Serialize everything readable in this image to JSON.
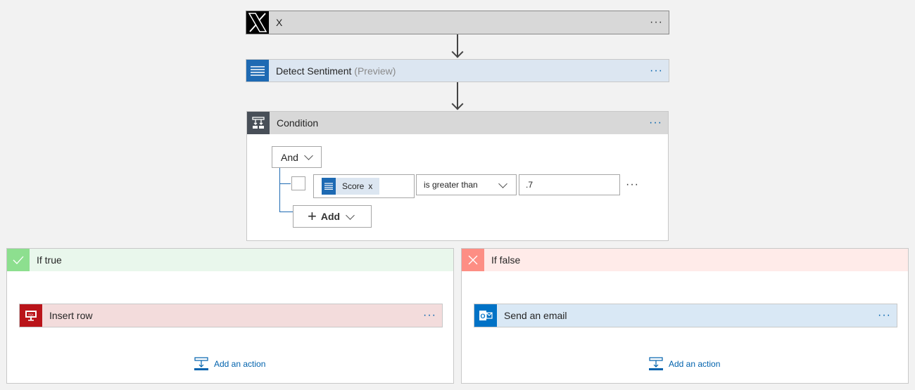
{
  "trigger": {
    "title": "X",
    "icon": "x-logo-icon",
    "more": "···"
  },
  "sentiment": {
    "title": "Detect Sentiment",
    "suffix": "(Preview)",
    "icon": "text-lines-icon",
    "more": "···"
  },
  "condition": {
    "title": "Condition",
    "icon": "condition-icon",
    "more": "···",
    "group_operator": "And",
    "row": {
      "token_label": "Score",
      "token_remove": "x",
      "operator": "is greater than",
      "value": ".7",
      "more": "···"
    },
    "add_label": "Add"
  },
  "branches": {
    "true": {
      "title": "If true",
      "color": "#8ddf8f",
      "action": {
        "title": "Insert row",
        "icon": "sql-icon",
        "color": "#ba141a",
        "more": "···"
      },
      "add_action": "Add an action"
    },
    "false": {
      "title": "If false",
      "color": "#fd8e84",
      "action": {
        "title": "Send an email",
        "icon": "outlook-icon",
        "color": "#0072c6",
        "more": "···"
      },
      "add_action": "Add an action"
    }
  }
}
